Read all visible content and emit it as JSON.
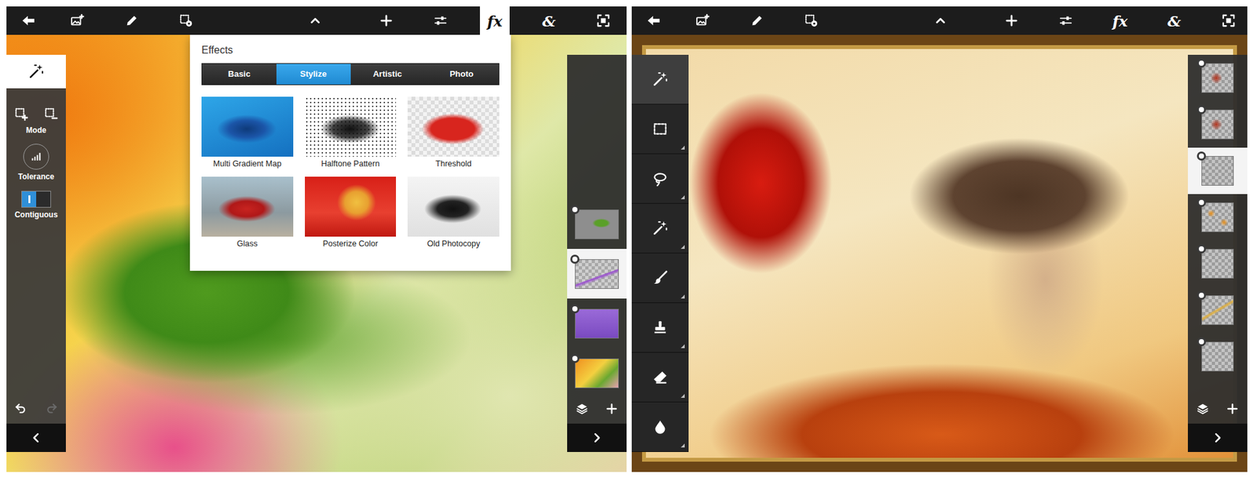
{
  "left_screen": {
    "toolbar": [
      {
        "kind": "back",
        "selected": false
      },
      {
        "kind": "add-image",
        "selected": false
      },
      {
        "kind": "pencil",
        "selected": false
      },
      {
        "kind": "selection-settings",
        "selected": false
      },
      {
        "kind": "caret-up",
        "selected": false
      },
      {
        "kind": "plus",
        "selected": false
      },
      {
        "kind": "sliders",
        "selected": false
      },
      {
        "kind": "text",
        "label": "fx",
        "selected": true
      },
      {
        "kind": "text",
        "label": "&",
        "selected": false
      },
      {
        "kind": "fit-screen",
        "selected": false
      }
    ],
    "tool_options": {
      "tool": {
        "kind": "wand",
        "selected": true
      },
      "mode": {
        "label": "Mode",
        "buttons": [
          {
            "kind": "select-add"
          },
          {
            "kind": "select-subtract"
          }
        ]
      },
      "tolerance": {
        "label": "Tolerance"
      },
      "contiguous": {
        "label": "Contiguous",
        "on": true
      },
      "undo": {
        "disabled": false
      },
      "redo": {
        "disabled": true
      }
    },
    "effects": {
      "title": "Effects",
      "tabs": [
        {
          "label": "Basic",
          "selected": false
        },
        {
          "label": "Stylize",
          "selected": true
        },
        {
          "label": "Artistic",
          "selected": false
        },
        {
          "label": "Photo",
          "selected": false
        }
      ],
      "items": [
        {
          "label": "Multi Gradient Map"
        },
        {
          "label": "Halftone Pattern"
        },
        {
          "label": "Threshold"
        },
        {
          "label": "Glass"
        },
        {
          "label": "Posterize Color"
        },
        {
          "label": "Old Photocopy"
        }
      ]
    },
    "layers": [
      {
        "visible": true,
        "selected": false
      },
      {
        "visible": true,
        "selected": true
      },
      {
        "visible": true,
        "selected": false
      },
      {
        "visible": true,
        "selected": false
      }
    ]
  },
  "right_screen": {
    "toolbar": [
      {
        "kind": "back",
        "selected": false
      },
      {
        "kind": "add-image",
        "selected": false
      },
      {
        "kind": "pencil",
        "selected": false
      },
      {
        "kind": "selection-settings",
        "selected": false
      },
      {
        "kind": "caret-up",
        "selected": false
      },
      {
        "kind": "plus",
        "selected": false
      },
      {
        "kind": "sliders",
        "selected": false
      },
      {
        "kind": "text",
        "label": "fx",
        "selected": false
      },
      {
        "kind": "text",
        "label": "&",
        "selected": false
      },
      {
        "kind": "fit-screen",
        "selected": false
      }
    ],
    "tools": [
      {
        "kind": "wand",
        "selected": true,
        "flyout": false
      },
      {
        "kind": "rect-select",
        "selected": false,
        "flyout": true
      },
      {
        "kind": "lasso",
        "selected": false,
        "flyout": true
      },
      {
        "kind": "wand",
        "selected": false,
        "flyout": true
      },
      {
        "kind": "brush",
        "selected": false,
        "flyout": true
      },
      {
        "kind": "stamp",
        "selected": false,
        "flyout": true
      },
      {
        "kind": "eraser",
        "selected": false,
        "flyout": true
      },
      {
        "kind": "drop",
        "selected": false,
        "flyout": true
      }
    ],
    "layers": [
      {
        "visible": true,
        "selected": false
      },
      {
        "visible": true,
        "selected": false
      },
      {
        "visible": true,
        "selected": true
      },
      {
        "visible": true,
        "selected": false
      },
      {
        "visible": true,
        "selected": false
      },
      {
        "visible": true,
        "selected": false
      },
      {
        "visible": true,
        "selected": false
      }
    ]
  }
}
